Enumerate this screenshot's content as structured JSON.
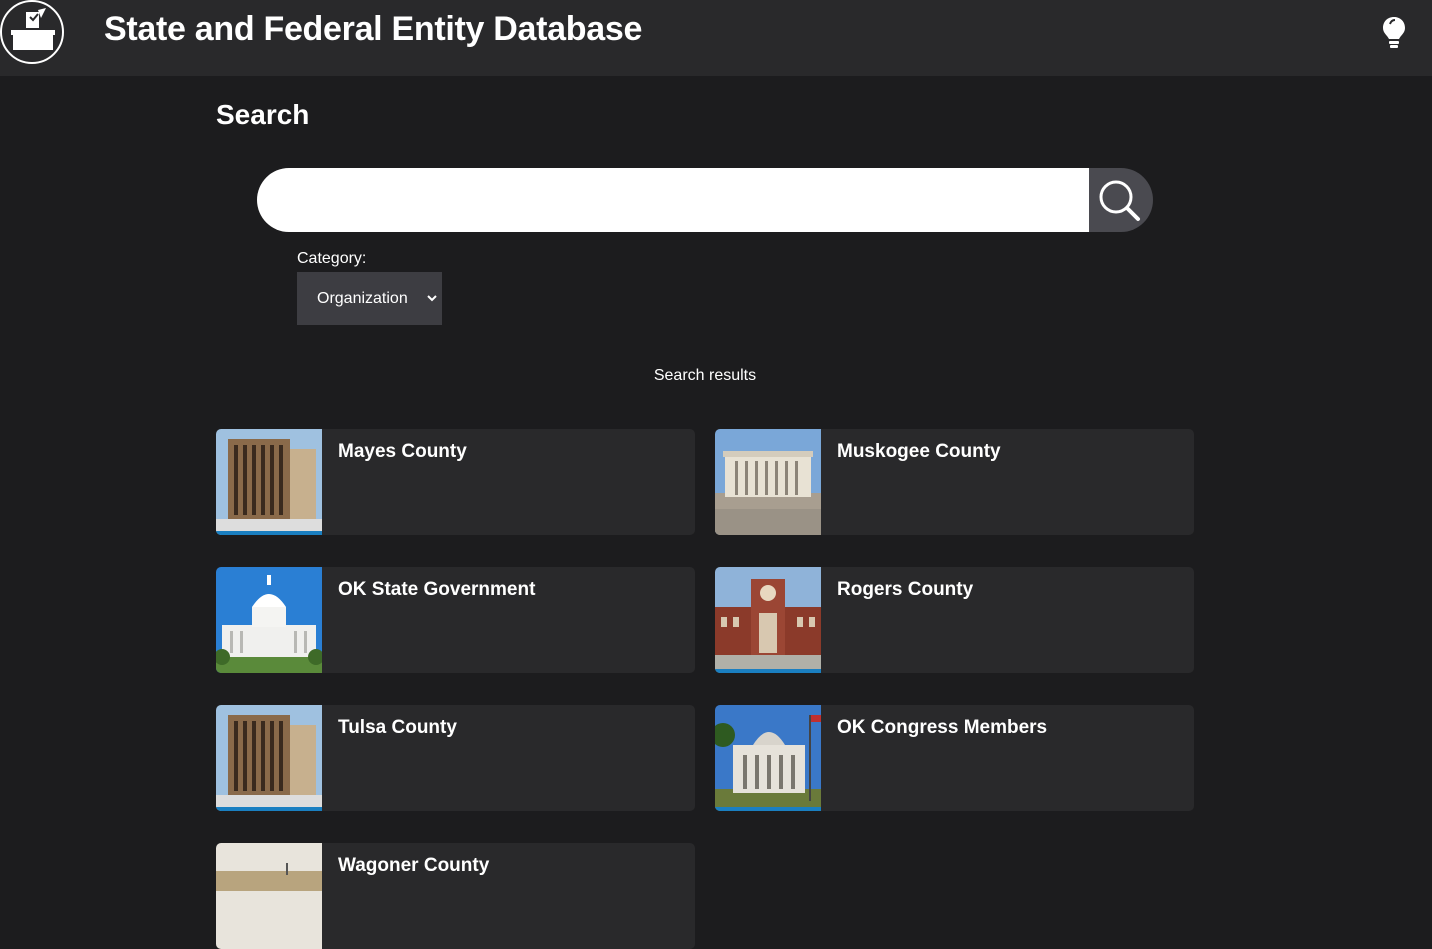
{
  "header": {
    "title": "State and Federal Entity Database",
    "logo_icon": "ballot-box-icon",
    "theme_icon": "lightbulb-icon"
  },
  "search": {
    "heading": "Search",
    "query": "",
    "placeholder": "",
    "button_icon": "search-icon"
  },
  "category": {
    "label": "Category:",
    "selected": "Organization"
  },
  "results": {
    "label": "Search results",
    "items": [
      {
        "name": "Mayes County",
        "image": "modern-brick-courthouse"
      },
      {
        "name": "Muskogee County",
        "image": "classical-courthouse"
      },
      {
        "name": "OK State Government",
        "image": "state-capitol-dome"
      },
      {
        "name": "Rogers County",
        "image": "brick-clocktower-courthouse"
      },
      {
        "name": "Tulsa County",
        "image": "modern-brick-courthouse"
      },
      {
        "name": "OK Congress Members",
        "image": "capitol-with-flag"
      },
      {
        "name": "Wagoner County",
        "image": "landscape-building"
      }
    ]
  },
  "colors": {
    "background": "#1c1c1e",
    "header": "#29292b",
    "card": "#29292b",
    "select": "#3d3d42",
    "search_button": "#4a4a50"
  }
}
